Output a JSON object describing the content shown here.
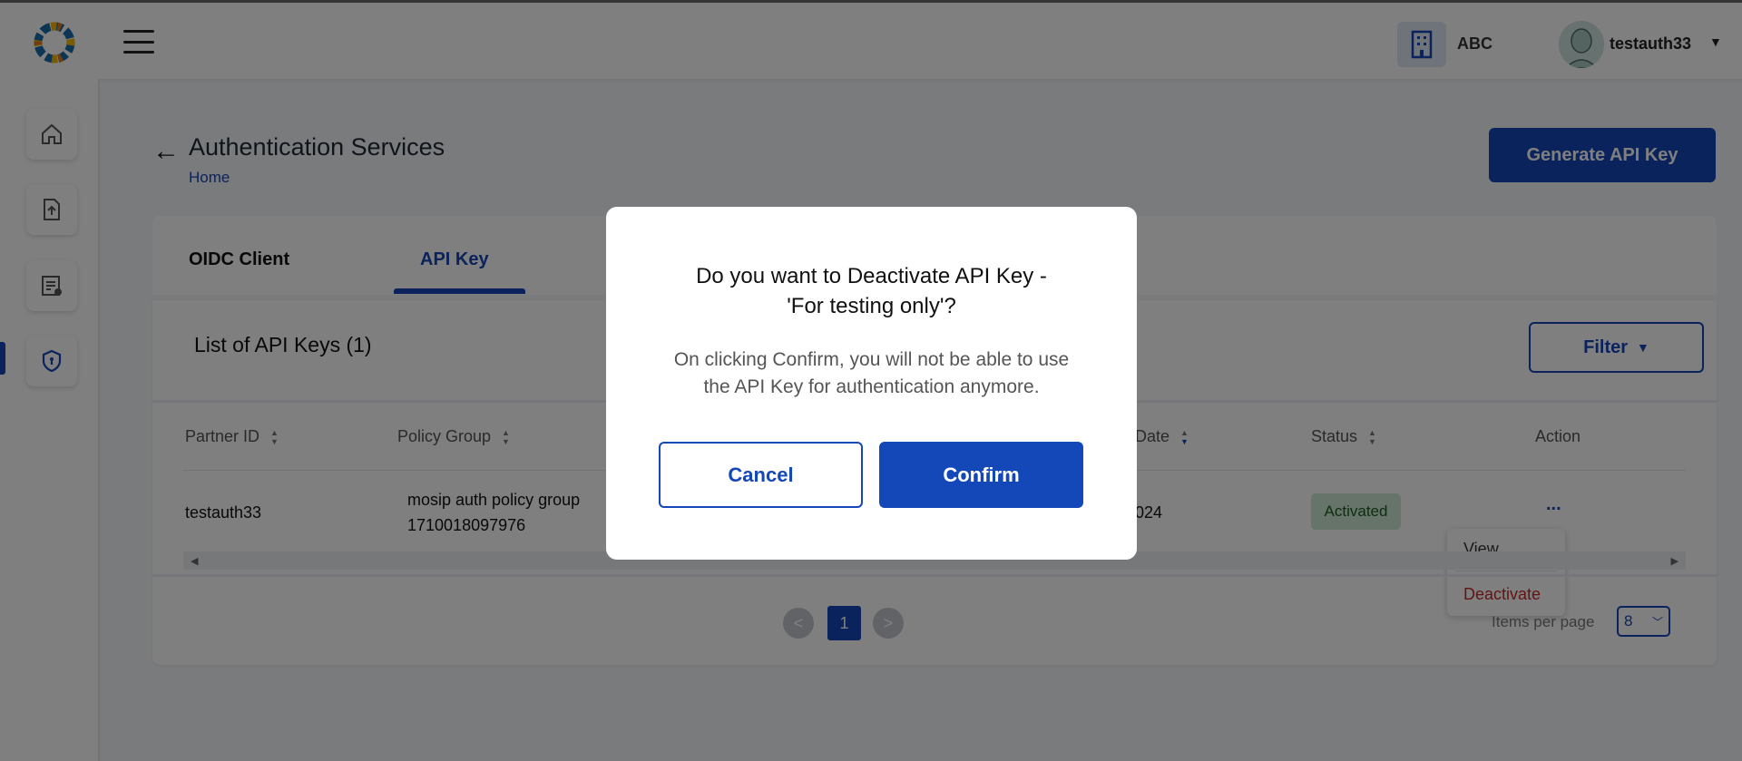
{
  "header": {
    "org_name": "ABC",
    "username": "testauth33",
    "icons": [
      "logo-icon",
      "hamburger-icon",
      "building-icon",
      "avatar",
      "caret-down-icon"
    ]
  },
  "sidebar": {
    "items": [
      {
        "icon": "home-icon",
        "active": false
      },
      {
        "icon": "upload-document-icon",
        "active": false
      },
      {
        "icon": "policy-document-icon",
        "active": false
      },
      {
        "icon": "shield-icon",
        "active": true
      }
    ]
  },
  "page": {
    "title": "Authentication Services",
    "breadcrumb": "Home",
    "generate_button": "Generate API Key"
  },
  "tabs": [
    {
      "label": "OIDC Client",
      "active": false
    },
    {
      "label": "API Key",
      "active": true
    }
  ],
  "list": {
    "title": "List of API Keys (1)",
    "filter_label": "Filter",
    "columns": {
      "partner_id": "Partner ID",
      "policy_group": "Policy Group",
      "date": "Date",
      "status": "Status",
      "action": "Action"
    },
    "row": {
      "partner_id": "testauth33",
      "policy_group_line1": "mosip auth policy group",
      "policy_group_line2": "1710018097976",
      "date_fragment": "024",
      "status": "Activated",
      "action": "..."
    },
    "action_menu": {
      "view": "View",
      "deactivate": "Deactivate"
    },
    "pagination": {
      "prev": "<",
      "current_page": "1",
      "next": ">",
      "items_per_page_label": "Items per page",
      "items_per_page": "8"
    }
  },
  "modal": {
    "title_line1": "Do you want to Deactivate API Key -",
    "title_line2": "'For testing only'?",
    "body_line1": "On clicking Confirm, you will not be able to use",
    "body_line2": "the API Key for authentication anymore.",
    "cancel_label": "Cancel",
    "confirm_label": "Confirm"
  },
  "colors": {
    "primary": "#1447b8",
    "status_active_bg": "#cde9d2",
    "status_active_text": "#1b5e20",
    "danger": "#c62828",
    "overlay": "rgba(0,0,0,0.5)"
  }
}
